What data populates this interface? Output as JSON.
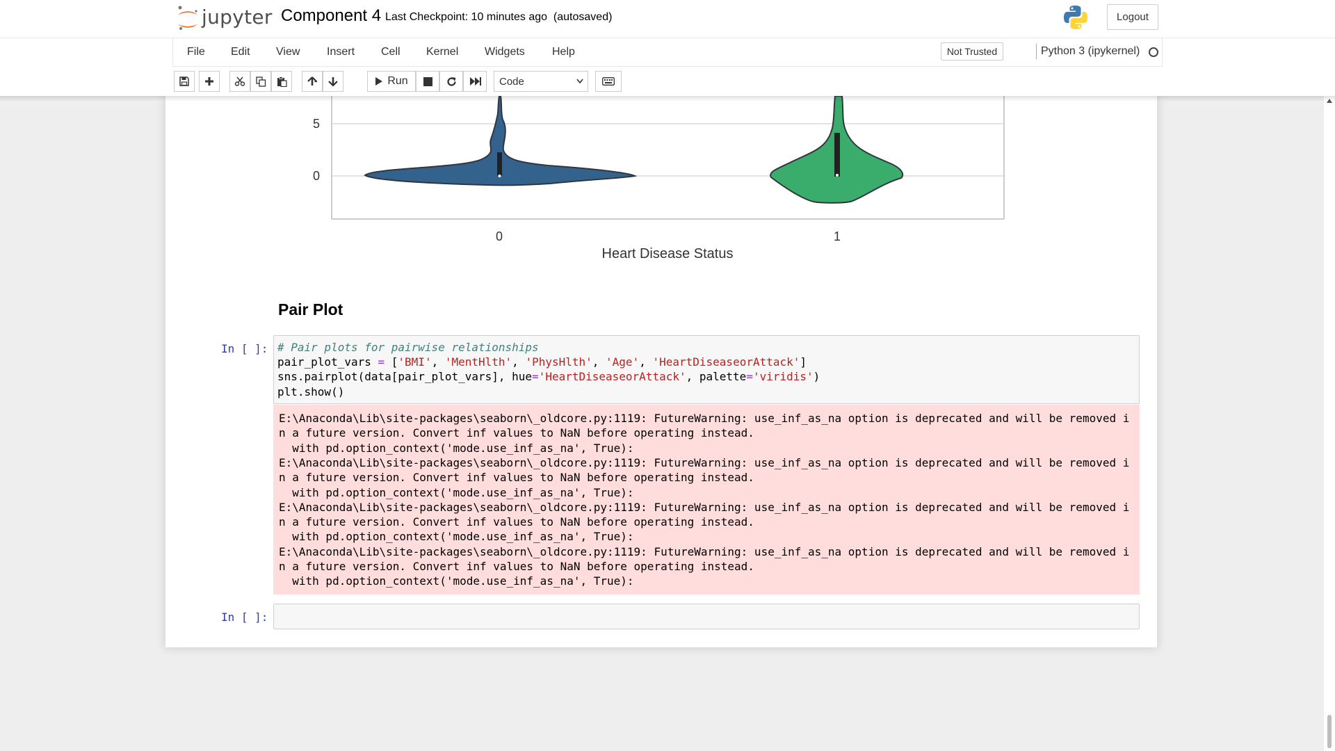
{
  "header": {
    "logo_text": "jupyter",
    "notebook_title": "Component 4",
    "checkpoint": "Last Checkpoint: 10 minutes ago",
    "autosave": "(autosaved)",
    "logout_label": "Logout"
  },
  "menubar": {
    "items": [
      "File",
      "Edit",
      "View",
      "Insert",
      "Cell",
      "Kernel",
      "Widgets",
      "Help"
    ],
    "trust_label": "Not Trusted",
    "kernel_name": "Python 3 (ipykernel)"
  },
  "toolbar": {
    "run_label": "Run",
    "cell_type": "Code",
    "icons": [
      "save-icon",
      "plus-icon",
      "cut-icon",
      "copy-icon",
      "paste-icon",
      "arrow-up-icon",
      "arrow-down-icon",
      "run-icon",
      "stop-icon",
      "restart-icon",
      "fast-forward-icon",
      "keyboard-icon"
    ]
  },
  "chart_data": {
    "type": "violin",
    "categories": [
      "0",
      "1"
    ],
    "xlabel": "Heart Disease Status",
    "ylabel": "",
    "yticks_visible": [
      0,
      5
    ],
    "colors": [
      "#33638d",
      "#3aad6d"
    ],
    "grid": true
  },
  "notebook": {
    "section_heading": "Pair Plot",
    "cell_prompt": "In [ ]:",
    "code": {
      "comment": "# Pair plots for pairwise relationships",
      "line2": [
        "pair_plot_vars ",
        "=",
        " [",
        "'BMI'",
        ", ",
        "'MentHlth'",
        ", ",
        "'PhysHlth'",
        ", ",
        "'Age'",
        ", ",
        "'HeartDiseaseorAttack'",
        "]"
      ],
      "line3": [
        "sns.pairplot(data[pair_plot_vars], hue",
        "=",
        "'HeartDiseaseorAttack'",
        ", palette",
        "=",
        "'viridis'",
        ")"
      ],
      "line4": "plt.show()"
    },
    "stderr_lines": [
      "E:\\Anaconda\\Lib\\site-packages\\seaborn\\_oldcore.py:1119: FutureWarning: use_inf_as_na option is deprecated and will be removed i",
      "n a future version. Convert inf values to NaN before operating instead.",
      "  with pd.option_context('mode.use_inf_as_na', True):",
      "E:\\Anaconda\\Lib\\site-packages\\seaborn\\_oldcore.py:1119: FutureWarning: use_inf_as_na option is deprecated and will be removed i",
      "n a future version. Convert inf values to NaN before operating instead.",
      "  with pd.option_context('mode.use_inf_as_na', True):",
      "E:\\Anaconda\\Lib\\site-packages\\seaborn\\_oldcore.py:1119: FutureWarning: use_inf_as_na option is deprecated and will be removed i",
      "n a future version. Convert inf values to NaN before operating instead.",
      "  with pd.option_context('mode.use_inf_as_na', True):",
      "E:\\Anaconda\\Lib\\site-packages\\seaborn\\_oldcore.py:1119: FutureWarning: use_inf_as_na option is deprecated and will be removed i",
      "n a future version. Convert inf values to NaN before operating instead.",
      "  with pd.option_context('mode.use_inf_as_na', True):"
    ],
    "empty_cell_prompt": "In [ ]:"
  }
}
